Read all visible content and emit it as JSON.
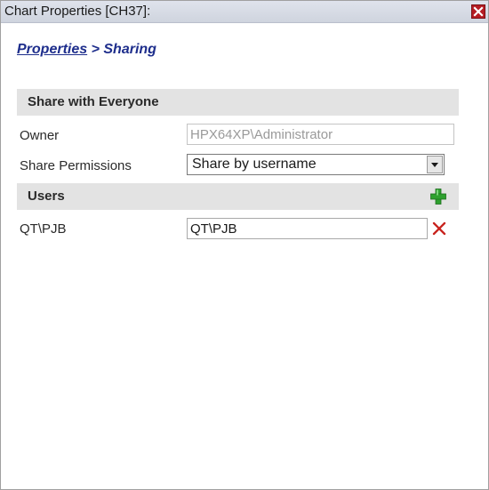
{
  "window": {
    "title": "Chart Properties [CH37]:",
    "close_icon": "close-icon",
    "accent_color": "#b51d24"
  },
  "breadcrumb": {
    "link_label": "Properties",
    "separator": " > ",
    "current": "Sharing"
  },
  "share_section": {
    "header": "Share with Everyone",
    "owner_label": "Owner",
    "owner_value": "HPX64XP\\Administrator",
    "permissions_label": "Share Permissions",
    "permissions_value": "Share by username"
  },
  "users_section": {
    "header": "Users",
    "add_icon": "plus-icon",
    "users": [
      {
        "label": "QT\\PJB",
        "value": "QT\\PJB",
        "remove_icon": "remove-x-icon"
      }
    ]
  }
}
